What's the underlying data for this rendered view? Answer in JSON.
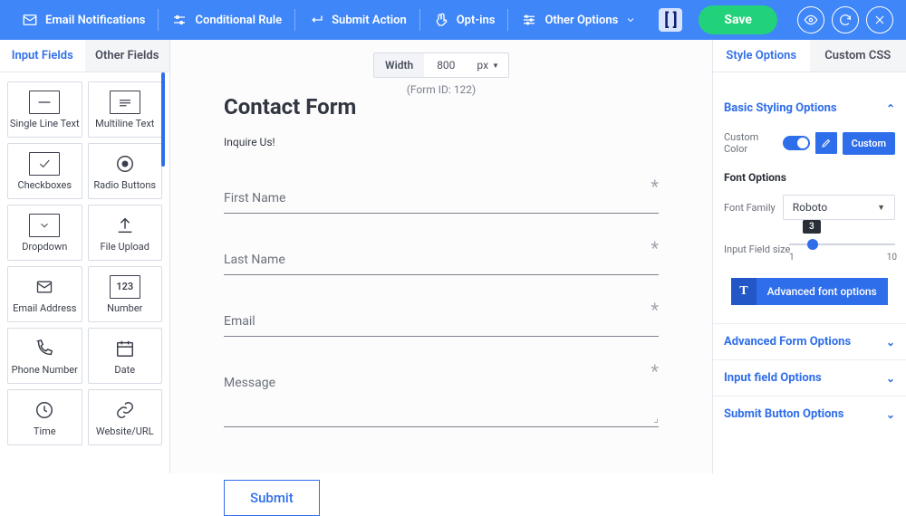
{
  "topbar": {
    "items": [
      {
        "label": "Email Notifications"
      },
      {
        "label": "Conditional Rule"
      },
      {
        "label": "Submit Action"
      },
      {
        "label": "Opt-ins"
      },
      {
        "label": "Other Options"
      }
    ],
    "save": "Save"
  },
  "left": {
    "tabs": {
      "input": "Input Fields",
      "other": "Other Fields"
    },
    "fields": [
      {
        "label": "Single Line Text"
      },
      {
        "label": "Multiline Text"
      },
      {
        "label": "Checkboxes"
      },
      {
        "label": "Radio Buttons"
      },
      {
        "label": "Dropdown"
      },
      {
        "label": "File Upload"
      },
      {
        "label": "Email Address"
      },
      {
        "label": "Number"
      },
      {
        "label": "Phone Number"
      },
      {
        "label": "Date"
      },
      {
        "label": "Time"
      },
      {
        "label": "Website/URL"
      }
    ]
  },
  "canvas": {
    "width_label": "Width",
    "width_value": "800",
    "width_unit": "px",
    "form_id": "(Form ID: 122)",
    "title": "Contact Form",
    "subtitle": "Inquire Us!",
    "fields": {
      "first": "First Name",
      "last": "Last Name",
      "email": "Email",
      "message": "Message"
    },
    "submit": "Submit"
  },
  "right": {
    "tabs": {
      "style": "Style Options",
      "css": "Custom CSS"
    },
    "basic_head": "Basic Styling Options",
    "custom_color_label": "Custom Color",
    "custom_btn": "Custom",
    "font_head": "Font Options",
    "font_family_label": "Font Family",
    "font_family_value": "Roboto",
    "size_label": "Input Field size",
    "size_value": "3",
    "size_min": "1",
    "size_max": "10",
    "adv_font_btn": "Advanced font options",
    "adv_form": "Advanced Form Options",
    "input_opts": "Input field Options",
    "submit_opts": "Submit Button Options"
  }
}
